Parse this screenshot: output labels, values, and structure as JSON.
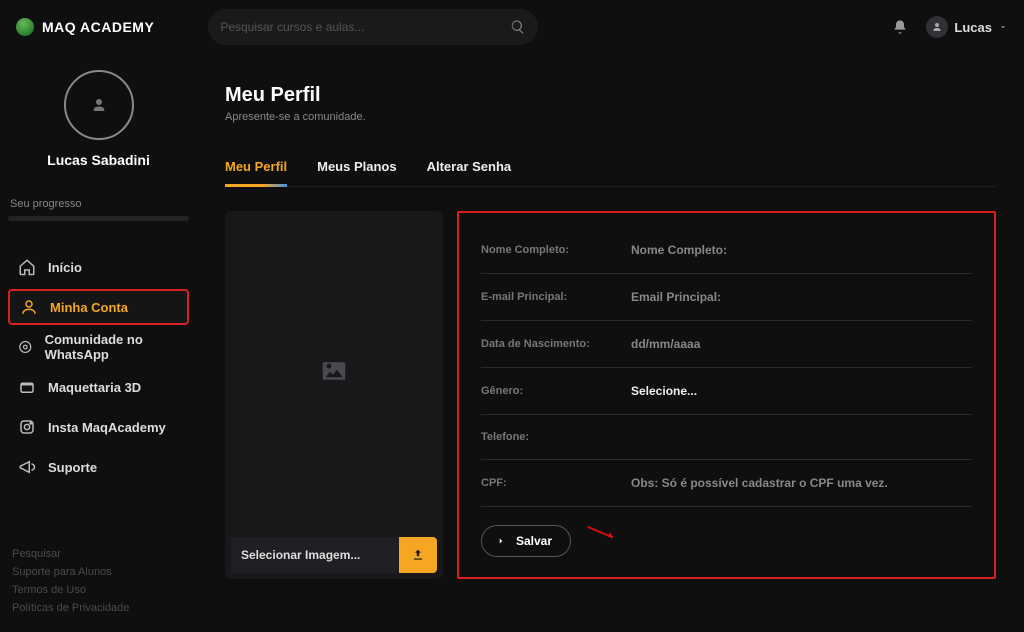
{
  "header": {
    "brand": "MAQ ACADEMY",
    "search_placeholder": "Pesquisar cursos e aulas...",
    "user_name": "Lucas"
  },
  "sidebar": {
    "display_name": "Lucas Sabadini",
    "progress_label": "Seu progresso",
    "items": [
      {
        "label": "Início"
      },
      {
        "label": "Minha Conta"
      },
      {
        "label": "Comunidade no WhatsApp"
      },
      {
        "label": "Maquettaria 3D"
      },
      {
        "label": "Insta MaqAcademy"
      },
      {
        "label": "Suporte"
      }
    ],
    "footer": [
      "Pesquisar",
      "Suporte para Alunos",
      "Termos de Uso",
      "Políticas de Privacidade"
    ]
  },
  "page": {
    "title": "Meu Perfil",
    "subtitle": "Apresente-se a comunidade.",
    "tabs": [
      "Meu Perfil",
      "Meus Planos",
      "Alterar Senha"
    ],
    "image_button": "Selecionar Imagem...",
    "fields": {
      "nome_label": "Nome Completo:",
      "nome_ph": "Nome Completo:",
      "email_label": "E-mail Principal:",
      "email_ph": "Email Principal:",
      "nasc_label": "Data de Nascimento:",
      "nasc_ph": "dd/mm/aaaa",
      "genero_label": "Gênero:",
      "genero_val": "Selecione...",
      "tel_label": "Telefone:",
      "tel_val": "",
      "cpf_label": "CPF:",
      "cpf_note": "Obs: Só é possível cadastrar o CPF uma vez."
    },
    "save": "Salvar"
  }
}
